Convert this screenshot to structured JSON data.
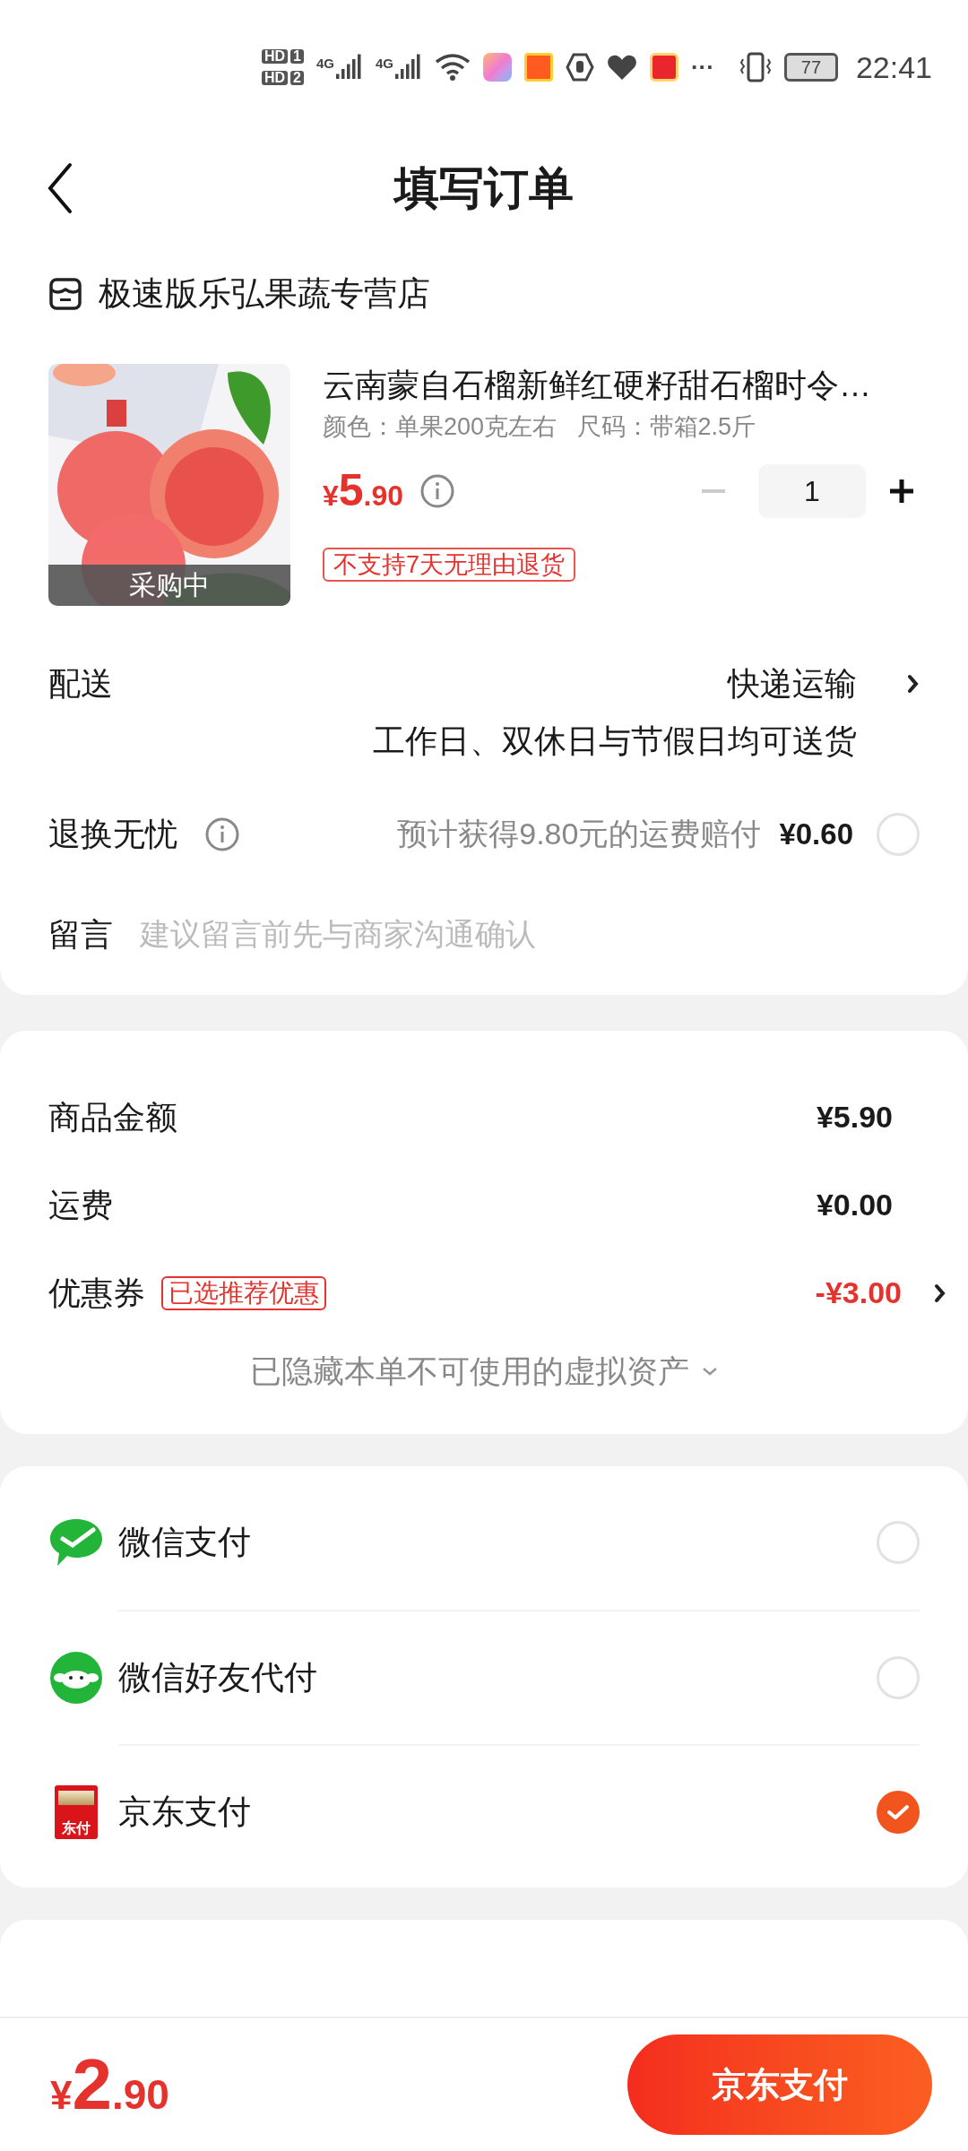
{
  "status_bar": {
    "sims": [
      {
        "hd": "HD",
        "slot": "1"
      },
      {
        "hd": "HD",
        "slot": "2"
      }
    ],
    "networks": [
      "4G",
      "4G"
    ],
    "more": "···",
    "battery": "77",
    "time": "22:41"
  },
  "header": {
    "title": "填写订单"
  },
  "order": {
    "store": "极速版乐弘果蔬专营店",
    "product": {
      "image_badge": "采购中",
      "title": "云南蒙自石榴新鲜红硬籽甜石榴时令…",
      "spec": "颜色：单果200克左右   尺码：带箱2.5斤",
      "price": {
        "currency": "¥",
        "integer": "5",
        "decimal": ".90"
      },
      "quantity": "1",
      "minus_disabled": true,
      "tag": "不支持7天无理由退货"
    },
    "delivery": {
      "label": "配送",
      "method": "快递运输",
      "note": "工作日、双休日与节假日均可送货"
    },
    "returns": {
      "label": "退换无忧",
      "info": "预计获得9.80元的运费赔付",
      "price": "¥0.60",
      "checked": false
    },
    "message": {
      "label": "留言",
      "placeholder": "建议留言前先与商家沟通确认"
    }
  },
  "summary": {
    "rows": [
      {
        "kind": "plain",
        "label": "商品金额",
        "value": "¥5.90"
      },
      {
        "kind": "plain",
        "label": "运费",
        "value": "¥0.00"
      },
      {
        "kind": "coupon",
        "label": "优惠券",
        "tag": "已选推荐优惠",
        "value": "-¥3.00"
      }
    ],
    "hidden_note": "已隐藏本单不可使用的虚拟资产"
  },
  "payment": [
    {
      "kind": "wechat",
      "label": "微信支付",
      "selected": false
    },
    {
      "kind": "friend",
      "label": "微信好友代付",
      "selected": false
    },
    {
      "kind": "jd",
      "label": "京东支付",
      "logo_text": "东付",
      "selected": true
    }
  ],
  "footer": {
    "total": {
      "currency": "¥",
      "integer": "2",
      "decimal": ".90"
    },
    "pay_button": "京东支付"
  }
}
